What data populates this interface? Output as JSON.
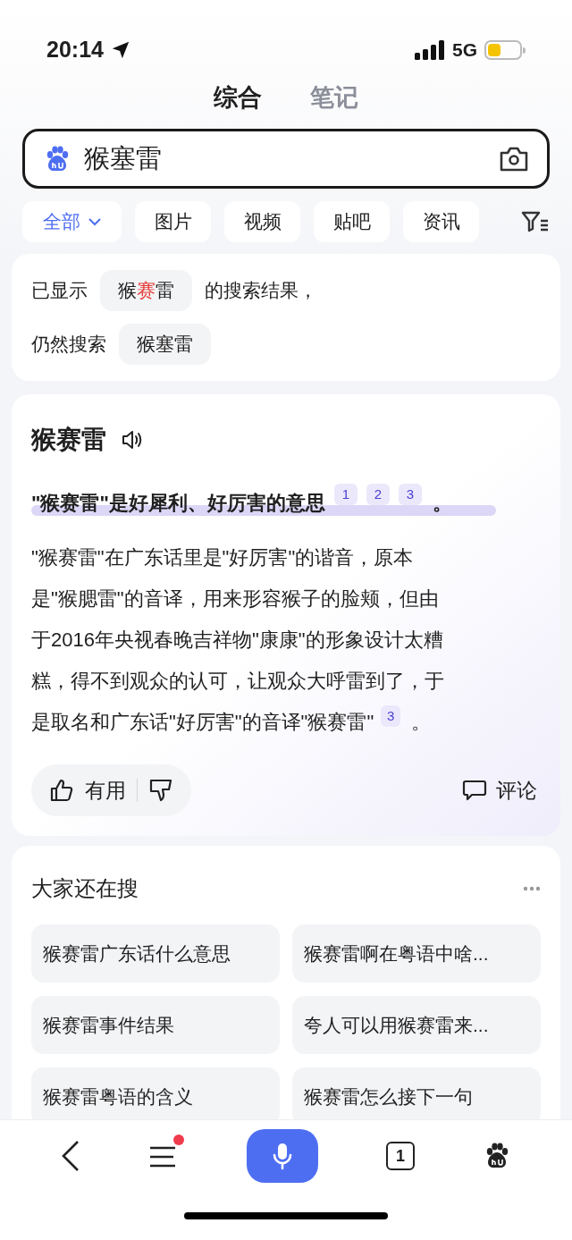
{
  "status_bar": {
    "time": "20:14",
    "network": "5G"
  },
  "tabs": [
    {
      "label": "综合",
      "selected": true
    },
    {
      "label": "笔记",
      "selected": false
    }
  ],
  "search": {
    "value": "猴塞雷"
  },
  "filters": [
    {
      "label": "全部",
      "selected": true,
      "kind": "dropdown"
    },
    {
      "label": "图片",
      "selected": false,
      "kind": "plain"
    },
    {
      "label": "视频",
      "selected": false,
      "kind": "plain"
    },
    {
      "label": "贴吧",
      "selected": false,
      "kind": "plain"
    },
    {
      "label": "资讯",
      "selected": false,
      "kind": "plain"
    }
  ],
  "correction": {
    "shown_prefix": "已显示",
    "shown_query": [
      {
        "text": "猴",
        "highlight": false
      },
      {
        "text": "赛",
        "highlight": true
      },
      {
        "text": "雷",
        "highlight": false
      }
    ],
    "shown_suffix": "的搜索结果，",
    "still_prefix": "仍然搜索",
    "original_query": "猴塞雷"
  },
  "answer": {
    "title": "猴赛雷",
    "summary": "\"猴赛雷\"是好犀利、好厉害的意思",
    "summary_citations": [
      "1",
      "2",
      "3"
    ],
    "summary_end": "。",
    "body_lines": [
      "\"猴赛雷\"在广东话里是\"好厉害\"的谐音，原本",
      "是\"猴腮雷\"的音译，用来形容猴子的脸颊，但由",
      "于2016年央视春晚吉祥物\"康康\"的形象设计太糟",
      "糕，得不到观众的认可，让观众大呼雷到了，于",
      "是取名和广东话\"好厉害\"的音译\"猴赛雷\""
    ],
    "body_citations": [
      "3"
    ],
    "body_end": "。",
    "useful_label": "有用",
    "comment_label": "评论"
  },
  "related": {
    "title": "大家还在搜",
    "items": [
      "猴赛雷广东话什么意思",
      "猴赛雷啊在粤语中啥...",
      "猴赛雷事件结果",
      "夸人可以用猴赛雷来...",
      "猴赛雷粤语的含义",
      "猴赛雷怎么接下一句"
    ]
  },
  "bottom_nav": {
    "tab_count": "1",
    "has_notification": true
  }
}
